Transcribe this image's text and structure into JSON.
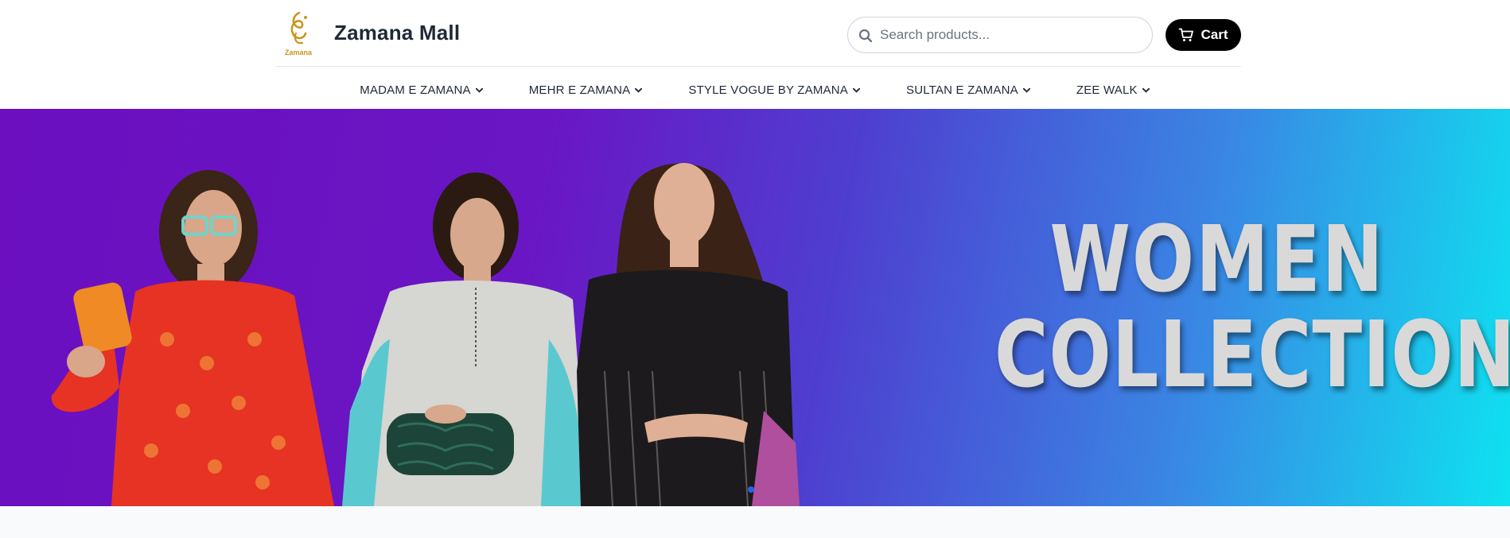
{
  "brand": {
    "name": "Zamana Mall",
    "logo_text": "Zamana",
    "logo_color": "#c8961e"
  },
  "search": {
    "placeholder": "Search products...",
    "icon": "search-icon"
  },
  "cart": {
    "label": "Cart",
    "icon": "cart-icon"
  },
  "nav": {
    "items": [
      {
        "label": "MADAM E ZAMANA",
        "icon": "chevron-down-icon"
      },
      {
        "label": "MEHR E ZAMANA",
        "icon": "chevron-down-icon"
      },
      {
        "label": "STYLE VOGUE BY ZAMANA",
        "icon": "chevron-down-icon"
      },
      {
        "label": "SULTAN E ZAMANA",
        "icon": "chevron-down-icon"
      },
      {
        "label": "ZEE WALK",
        "icon": "chevron-down-icon"
      }
    ]
  },
  "hero": {
    "line1": "WOMEN",
    "line2": "COLLECTION",
    "colors": {
      "start": "#6b0fbf",
      "end": "#0ee2f0"
    }
  },
  "colors": {
    "cart_bg": "#000000",
    "slider_dot": "#2563eb"
  }
}
